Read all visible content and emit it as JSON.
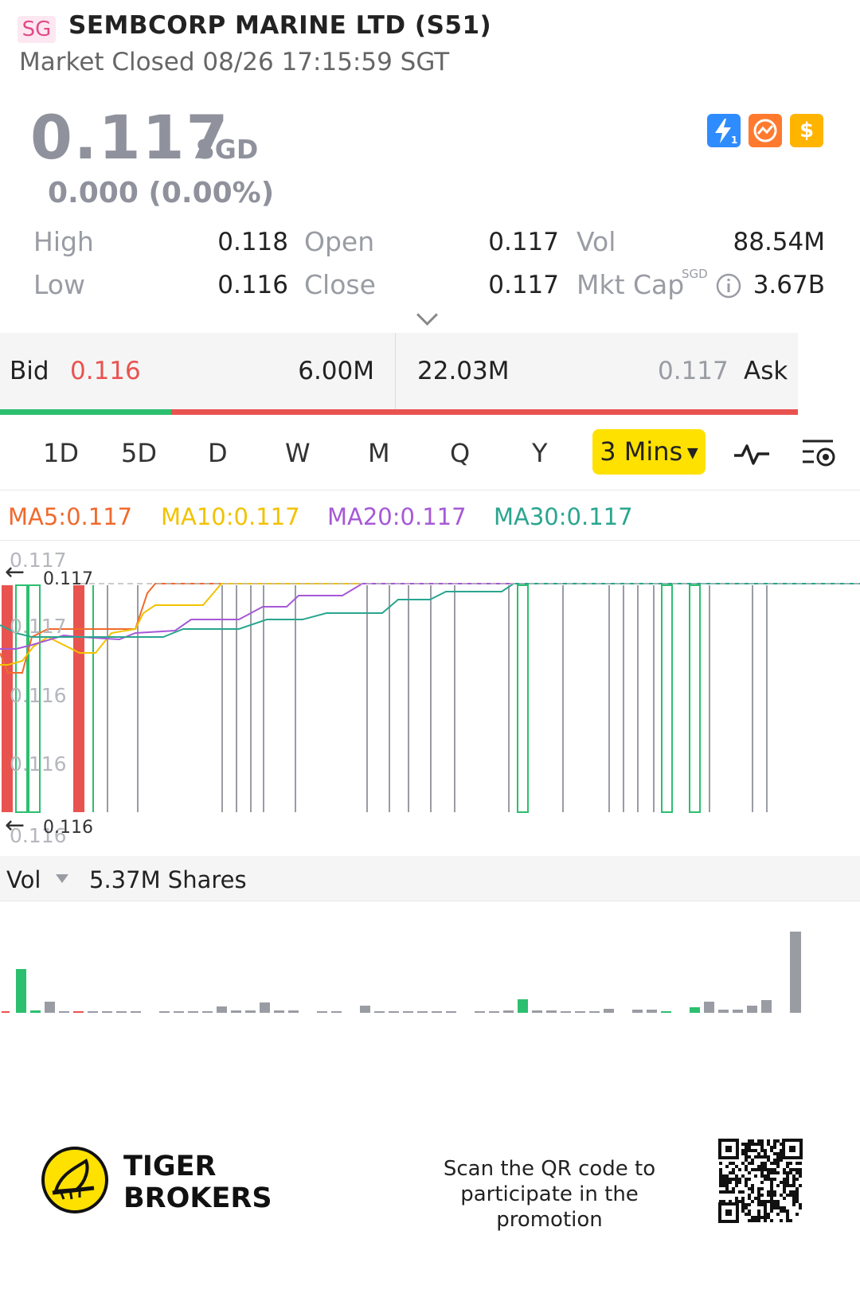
{
  "header": {
    "badge": "SG",
    "title": "SEMBCORP MARINE LTD (S51)",
    "status": "Market Closed 08/26 17:15:59 SGT"
  },
  "quote": {
    "price": "0.117",
    "currency": "SGD",
    "change": "0.000 (0.00%)",
    "icons": [
      "lightning-level1-icon",
      "chart-swap-icon",
      "dollar-icon"
    ]
  },
  "stats": {
    "high_label": "High",
    "high": "0.118",
    "low_label": "Low",
    "low": "0.116",
    "open_label": "Open",
    "open": "0.117",
    "close_label": "Close",
    "close": "0.117",
    "vol_label": "Vol",
    "vol": "88.54M",
    "mktcap_label": "Mkt Cap",
    "mktcap_currency": "SGD",
    "mktcap": "3.67B"
  },
  "orderbook": {
    "bid_label": "Bid",
    "bid_price": "0.116",
    "bid_size": "6.00M",
    "ask_size": "22.03M",
    "ask_price": "0.117",
    "ask_label": "Ask",
    "bid_fraction": 0.214
  },
  "tabs": [
    "1D",
    "5D",
    "D",
    "W",
    "M",
    "Q",
    "Y"
  ],
  "active_tab": "3 Mins",
  "indicators": {
    "ma5": "MA5:0.117",
    "ma10": "MA10:0.117",
    "ma20": "MA20:0.117",
    "ma30": "MA30:0.117"
  },
  "colors": {
    "ma5": "#f06a2d",
    "ma10": "#f2c200",
    "ma20": "#a659d6",
    "ma30": "#2aa58f",
    "up": "#2cbf6f",
    "down": "#e9534f",
    "neutral": "#9a9ca4"
  },
  "chart_labels": {
    "y_top": "0.117",
    "y_mid1": "0.117",
    "y_mid2": "0.116",
    "y_mid3": "0.116",
    "y_bottom": "0.116",
    "high_marker": "0.117",
    "low_marker": "0.116"
  },
  "volume": {
    "label": "Vol",
    "value": "5.37M Shares"
  },
  "footer": {
    "brand_line1": "TIGER",
    "brand_line2": "BROKERS",
    "promo": "Scan the QR code to participate in the promotion"
  }
}
